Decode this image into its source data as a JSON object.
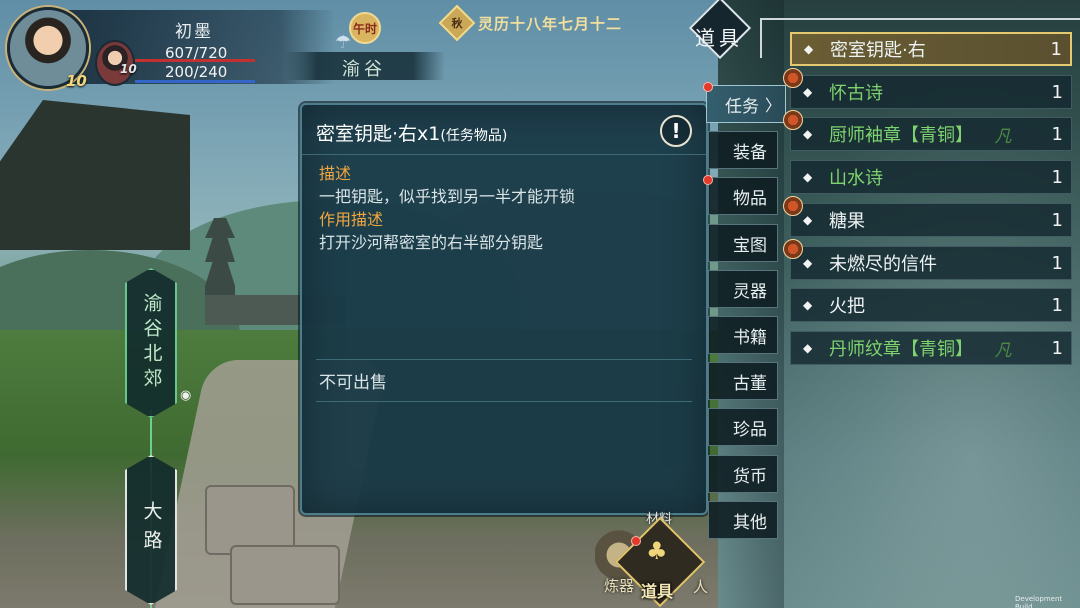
{
  "hud": {
    "character_name": "初墨",
    "hp": "607/720",
    "mp": "200/240",
    "level": "10",
    "companion_level": "10",
    "time_label": "午时",
    "location": "渝谷",
    "season_badge": "秋",
    "date": "灵历十八年七月十二",
    "weather_icon": "rain-cloud-icon"
  },
  "map": {
    "current_node": "渝谷北郊",
    "next_node": "大路"
  },
  "detail": {
    "title": "密室钥匙·右x1",
    "title_tag": "(任务物品)",
    "info_symbol": "!",
    "desc_label": "描述",
    "desc_text": "一把钥匙，似乎找到另一半才能开锁",
    "effect_label": "作用描述",
    "effect_text": "打开沙河帮密室的右半部分钥匙",
    "sell_status": "不可出售"
  },
  "toolbar": {
    "top_label": "材料",
    "left_label": "炼器",
    "bag_label": "道具",
    "side_label": "人"
  },
  "panel": {
    "title": "道具",
    "tabs": [
      {
        "label": "任务",
        "active": true
      },
      {
        "label": "装备"
      },
      {
        "label": "物品"
      },
      {
        "label": "宝图"
      },
      {
        "label": "灵器"
      },
      {
        "label": "书籍"
      },
      {
        "label": "古董"
      },
      {
        "label": "珍品"
      },
      {
        "label": "货币"
      },
      {
        "label": "其他"
      }
    ],
    "items": [
      {
        "name": "密室钥匙·右",
        "qty": "1",
        "rarity": ""
      },
      {
        "name": "怀古诗",
        "qty": "1",
        "rarity": ""
      },
      {
        "name": "厨师袖章【青铜】",
        "qty": "1",
        "rarity": "凡"
      },
      {
        "name": "山水诗",
        "qty": "1",
        "rarity": ""
      },
      {
        "name": "糖果",
        "qty": "1",
        "rarity": ""
      },
      {
        "name": "未燃尽的信件",
        "qty": "1",
        "rarity": ""
      },
      {
        "name": "火把",
        "qty": "1",
        "rarity": ""
      },
      {
        "name": "丹师纹章【青铜】",
        "qty": "1",
        "rarity": "凡"
      }
    ]
  },
  "footer": {
    "build_label": "Development Build"
  },
  "colors": {
    "accent_gold": "#e5c970",
    "item_green": "#7fd36e",
    "label_orange": "#f0a640",
    "alert_red": "#e23a2a"
  }
}
